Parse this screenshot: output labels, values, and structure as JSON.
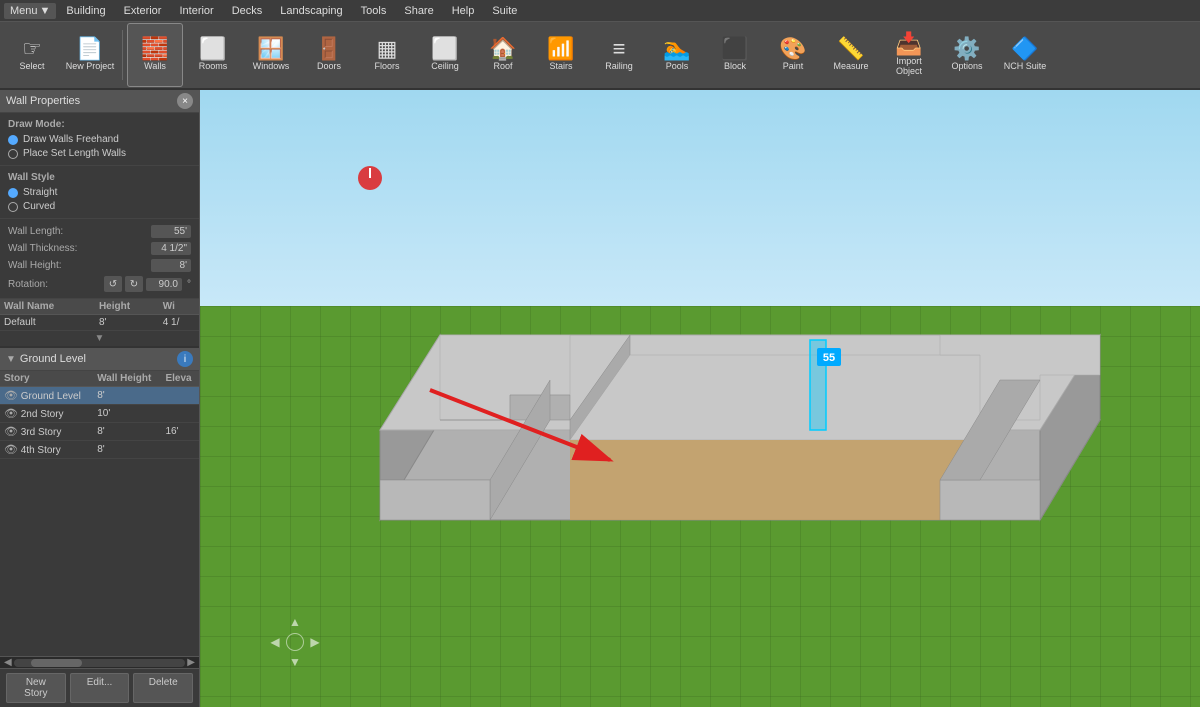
{
  "menubar": {
    "menu_label": "Menu",
    "items": [
      "Building",
      "Exterior",
      "Interior",
      "Decks",
      "Landscaping",
      "Tools",
      "Share",
      "Help",
      "Suite"
    ]
  },
  "toolbar": {
    "tools": [
      {
        "id": "select",
        "label": "Select",
        "icon": "☞"
      },
      {
        "id": "new-project",
        "label": "New Project",
        "icon": "📄"
      },
      {
        "id": "walls",
        "label": "Walls",
        "icon": "🧱"
      },
      {
        "id": "rooms",
        "label": "Rooms",
        "icon": "⬜"
      },
      {
        "id": "windows",
        "label": "Windows",
        "icon": "🪟"
      },
      {
        "id": "doors",
        "label": "Doors",
        "icon": "🚪"
      },
      {
        "id": "floors",
        "label": "Floors",
        "icon": "▦"
      },
      {
        "id": "ceiling",
        "label": "Ceiling",
        "icon": "⬜"
      },
      {
        "id": "roof",
        "label": "Roof",
        "icon": "🏠"
      },
      {
        "id": "stairs",
        "label": "Stairs",
        "icon": "📶"
      },
      {
        "id": "railing",
        "label": "Railing",
        "icon": "≡"
      },
      {
        "id": "pools",
        "label": "Pools",
        "icon": "🏊"
      },
      {
        "id": "block",
        "label": "Block",
        "icon": "⬛"
      },
      {
        "id": "paint",
        "label": "Paint",
        "icon": "🎨"
      },
      {
        "id": "measure",
        "label": "Measure",
        "icon": "📏"
      },
      {
        "id": "import-object",
        "label": "Import Object",
        "icon": "📥"
      },
      {
        "id": "options",
        "label": "Options",
        "icon": "⚙️"
      },
      {
        "id": "nch-suite",
        "label": "NCH Suite",
        "icon": "🔷"
      }
    ]
  },
  "wall_properties": {
    "title": "Wall Properties",
    "draw_mode_label": "Draw Mode:",
    "draw_modes": [
      {
        "label": "Draw Walls Freehand",
        "checked": true
      },
      {
        "label": "Place Set Length Walls",
        "checked": false
      }
    ],
    "wall_style_label": "Wall Style",
    "wall_styles": [
      {
        "label": "Straight",
        "checked": true
      },
      {
        "label": "Curved",
        "checked": false
      }
    ],
    "props": [
      {
        "label": "Wall Length:",
        "value": "55'"
      },
      {
        "label": "Wall Thickness:",
        "value": "4 1/2\""
      },
      {
        "label": "Wall Height:",
        "value": "8'"
      }
    ],
    "rotation_label": "Rotation:",
    "rotation_value": "90.0",
    "table_headers": [
      "Wall Name",
      "Height",
      "Wi"
    ],
    "table_rows": [
      {
        "name": "Default",
        "height": "8'",
        "width": "4 1/"
      }
    ]
  },
  "ground_level": {
    "title": "Ground Level",
    "table_headers": [
      "Story",
      "Wall Height",
      "Eleva"
    ],
    "stories": [
      {
        "name": "Ground Level",
        "wall_height": "8'",
        "elevation": "",
        "active": true
      },
      {
        "name": "2nd Story",
        "wall_height": "10'",
        "elevation": "",
        "active": false
      },
      {
        "name": "3rd Story",
        "wall_height": "8'",
        "elevation": "16'",
        "active": false
      },
      {
        "name": "4th Story",
        "wall_height": "8'",
        "elevation": "",
        "active": false
      }
    ],
    "buttons": {
      "new_story": "New Story",
      "edit": "Edit...",
      "delete": "Delete"
    }
  },
  "viewport": {
    "measure_value": "55",
    "nav": {
      "up": "▲",
      "down": "▼",
      "left": "◀",
      "right": "▶"
    }
  },
  "colors": {
    "accent": "#00aaff",
    "active_story": "#4a6a8a",
    "panel_bg": "#3a3a3a",
    "toolbar_bg": "#4a4a4a"
  }
}
